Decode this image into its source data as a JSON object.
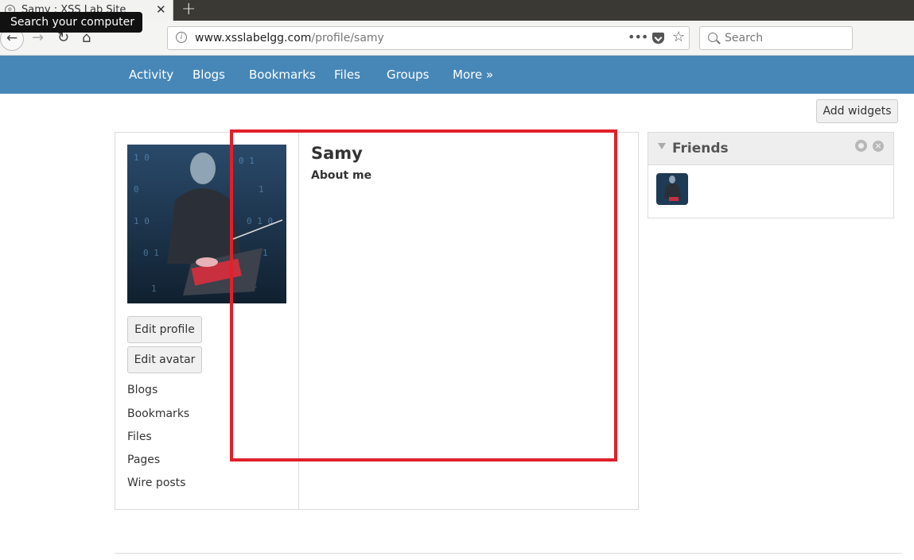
{
  "browser": {
    "tab_title": "Samy : XSS Lab Site",
    "tooltip": "Search your computer",
    "url_host": "www.xsslabelgg.com",
    "url_path": "/profile/samy",
    "search_placeholder": "Search"
  },
  "site_nav": {
    "items": [
      {
        "label": "Activity"
      },
      {
        "label": "Blogs"
      },
      {
        "label": "Bookmarks"
      },
      {
        "label": "Files"
      },
      {
        "label": "Groups"
      },
      {
        "label": "More »"
      }
    ]
  },
  "page": {
    "add_widgets_label": "Add widgets"
  },
  "profile": {
    "name": "Samy",
    "about_label": "About me",
    "edit_profile_label": "Edit profile",
    "edit_avatar_label": "Edit avatar",
    "owner_links": [
      {
        "label": "Blogs"
      },
      {
        "label": "Bookmarks"
      },
      {
        "label": "Files"
      },
      {
        "label": "Pages"
      },
      {
        "label": "Wire posts"
      }
    ]
  },
  "friends_widget": {
    "title": "Friends"
  },
  "colors": {
    "nav_blue": "#4787b8",
    "highlight_red": "#e0202a"
  },
  "icons": [
    "back-icon",
    "forward-icon",
    "reload-icon",
    "home-icon",
    "info-icon",
    "page-actions-icon",
    "pocket-icon",
    "bookmark-star-icon",
    "search-icon",
    "gear-icon",
    "close-icon"
  ]
}
